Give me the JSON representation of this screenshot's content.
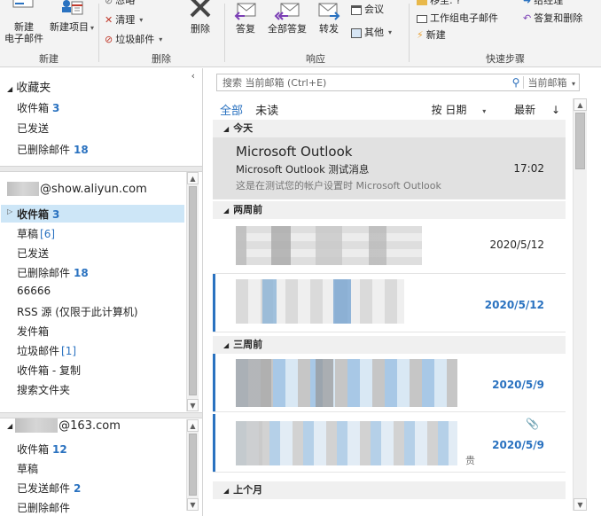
{
  "ribbon": {
    "new_email": {
      "line1": "新建",
      "line2": "电子邮件"
    },
    "new_items": {
      "line1": "新建项目"
    },
    "group_new": "新建",
    "ignore": "忽略",
    "cleanup": "清理",
    "junk": "垃圾邮件",
    "delete": "删除",
    "group_delete": "删除",
    "reply": "答复",
    "reply_all": "全部答复",
    "forward": "转发",
    "meeting": "会议",
    "more": "其他",
    "group_respond": "响应",
    "qs_move": "移至: ?",
    "qs_team_email": "工作组电子邮件",
    "qs_new": "新建",
    "qs_to_manager": "给经理",
    "qs_reply_delete": "答复和删除",
    "group_quicksteps": "快速步骤"
  },
  "folders": {
    "favorites_title": "收藏夹",
    "favorites": [
      {
        "label": "收件箱",
        "count": "3"
      },
      {
        "label": "已发送",
        "count": ""
      },
      {
        "label": "已删除邮件",
        "count": "18"
      }
    ],
    "account1": {
      "name": "@show.aliyun.com",
      "items": [
        {
          "label": "收件箱",
          "count": "3",
          "style": "bold"
        },
        {
          "label": "草稿",
          "count": "[6]",
          "style": "plain"
        },
        {
          "label": "已发送",
          "count": "",
          "style": ""
        },
        {
          "label": "已删除邮件",
          "count": "18",
          "style": "bold"
        },
        {
          "label": "66666",
          "count": "",
          "style": ""
        },
        {
          "label": "RSS 源 (仅限于此计算机)",
          "count": "",
          "style": ""
        },
        {
          "label": "发件箱",
          "count": "",
          "style": ""
        },
        {
          "label": "垃圾邮件",
          "count": "[1]",
          "style": "plain"
        },
        {
          "label": "收件箱 - 复制",
          "count": "",
          "style": ""
        },
        {
          "label": "搜索文件夹",
          "count": "",
          "style": ""
        }
      ]
    },
    "account2": {
      "name": "@163.com",
      "items": [
        {
          "label": "收件箱",
          "count": "12",
          "style": "bold"
        },
        {
          "label": "草稿",
          "count": "",
          "style": ""
        },
        {
          "label": "已发送邮件",
          "count": "2",
          "style": "bold"
        },
        {
          "label": "已删除邮件",
          "count": "",
          "style": ""
        }
      ]
    }
  },
  "messages": {
    "search_placeholder": "搜索 当前邮箱 (Ctrl+E)",
    "search_scope": "当前邮箱",
    "filter_all": "全部",
    "filter_unread": "未读",
    "sort_by": "按 日期",
    "sort_order": "最新",
    "groups": {
      "today": "今天",
      "two_weeks": "两周前",
      "three_weeks": "三周前",
      "last_month": "上个月"
    },
    "items": [
      {
        "sender": "Microsoft Outlook",
        "subject": "Microsoft Outlook 测试消息",
        "preview": "这是在测试您的帐户设置时 Microsoft Outlook",
        "time": "17:02"
      },
      {
        "time": "2020/5/12"
      },
      {
        "time": "2020/5/12"
      },
      {
        "time": "2020/5/9"
      },
      {
        "time": "2020/5/9",
        "tail": "贵"
      }
    ]
  },
  "colors": {
    "accent": "#2a72c0",
    "selection": "#cde6f7"
  }
}
